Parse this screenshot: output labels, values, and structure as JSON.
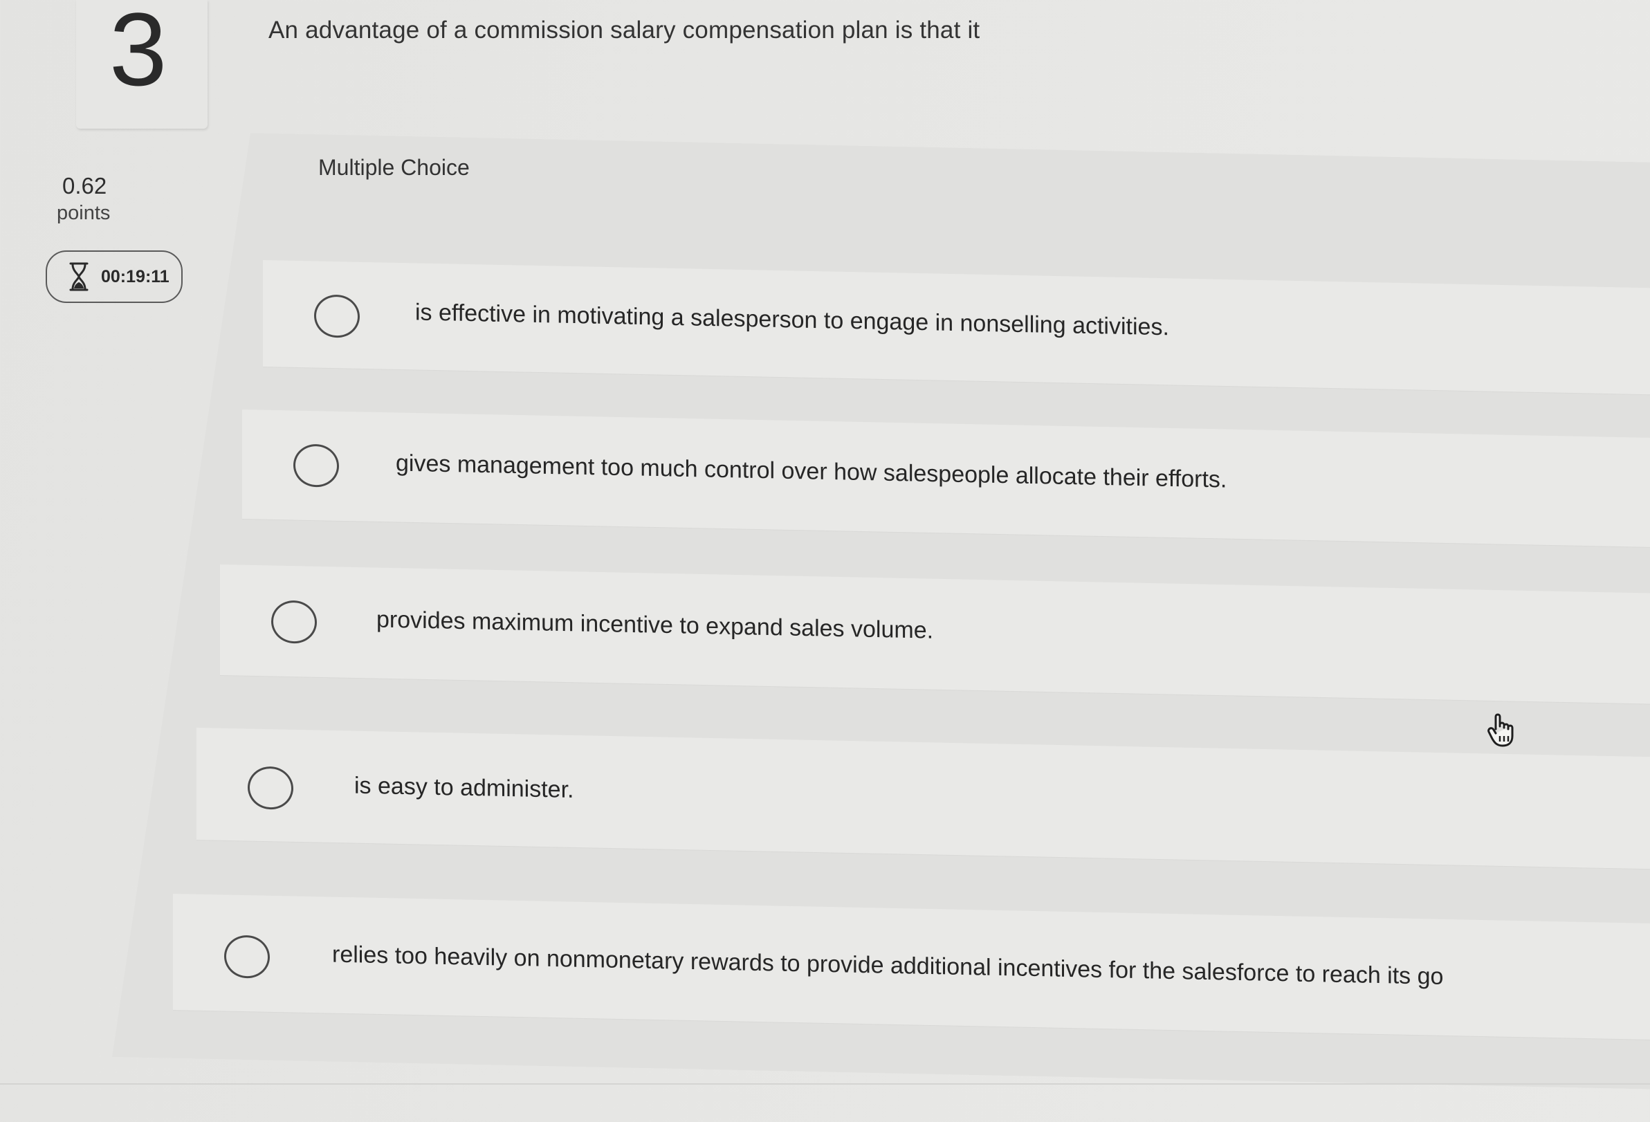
{
  "question": {
    "number": "3",
    "points_value": "0.62",
    "points_label": "points",
    "timer": "00:19:11",
    "text": "An advantage of a commission salary compensation plan is that it",
    "type_label": "Multiple Choice"
  },
  "choices": [
    {
      "text": "is effective in motivating a salesperson to engage in nonselling activities."
    },
    {
      "text": "gives management too much control over how salespeople allocate their efforts."
    },
    {
      "text": "provides maximum incentive to expand sales volume."
    },
    {
      "text": "is easy to administer."
    },
    {
      "text": "relies too heavily on nonmonetary rewards to provide additional incentives for the salesforce to reach its go"
    }
  ],
  "icons": {
    "timer": "hourglass-icon",
    "cursor": "hand-pointer-icon",
    "radio": "radio-circle"
  }
}
